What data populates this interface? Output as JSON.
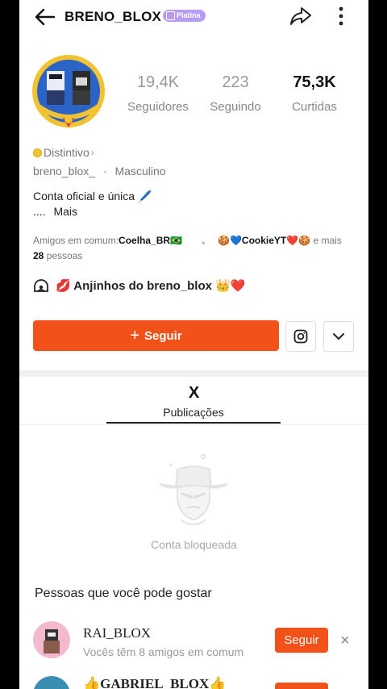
{
  "header": {
    "username": "BRENO_BLOX",
    "tier_badge": "Platina"
  },
  "profile": {
    "stats": [
      {
        "value": "19,4K",
        "label": "Seguidores"
      },
      {
        "value": "223",
        "label": "Seguindo"
      },
      {
        "value": "75,3K",
        "label": "Curtidas"
      }
    ],
    "distinctive_label": "Distintivo",
    "handle": "breno_blox_",
    "separator": "·",
    "gender": "Masculino",
    "bio_line1": "Conta oficial e única 🖊️",
    "bio_more_dots": "....",
    "bio_more": "Mais",
    "mutual_prefix": "Amigos em comum:",
    "mutual_name1": "Coelha_BR🇧🇷",
    "mutual_sep": "、",
    "mutual_name2": "🍪💙CookieYT❤️🍪",
    "mutual_suffix": " e mais",
    "mutual_count": "28",
    "mutual_people": " pessoas",
    "group_name": "💋 Anjinhos do breno_blox 👑❤️"
  },
  "actions": {
    "follow_label": "Seguir",
    "follow_plus": "+"
  },
  "tabs": {
    "active_icon": "X",
    "active_label": "Publicações"
  },
  "blocked": {
    "message": "Conta bloqueada"
  },
  "suggestions": {
    "title": "Pessoas que você pode gostar",
    "items": [
      {
        "name": "RAI_BLOX",
        "subtitle": "Vocês têm 8 amigos em comum",
        "button": "Seguir",
        "dismiss": "×"
      },
      {
        "name": "👍GABRIEL_BLOX👍",
        "button": "Seguir"
      }
    ]
  },
  "colors": {
    "accent": "#f2511a",
    "badge": "#b79cf4",
    "avatar_gold": "#f2c230"
  },
  "icons": [
    "back-arrow-icon",
    "share-icon",
    "more-vertical-icon",
    "instagram-icon",
    "chevron-down-icon",
    "group-icon",
    "blocked-account-icon",
    "close-icon"
  ]
}
